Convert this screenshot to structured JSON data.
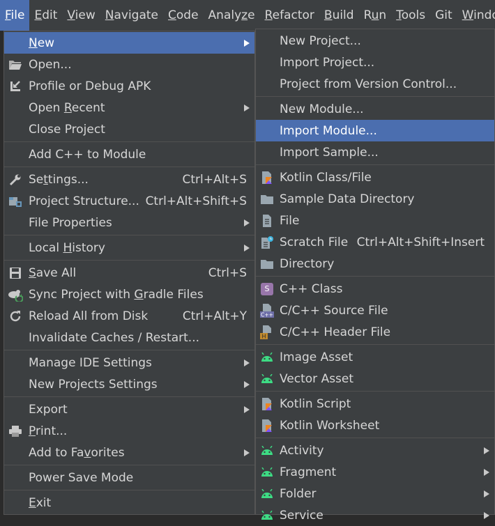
{
  "menubar": [
    {
      "pre": "",
      "u": "F",
      "post": "ile",
      "active": true
    },
    {
      "pre": "",
      "u": "E",
      "post": "dit"
    },
    {
      "pre": "",
      "u": "V",
      "post": "iew"
    },
    {
      "pre": "",
      "u": "N",
      "post": "avigate"
    },
    {
      "pre": "",
      "u": "C",
      "post": "ode"
    },
    {
      "pre": "Analy",
      "u": "z",
      "post": "e"
    },
    {
      "pre": "",
      "u": "R",
      "post": "efactor"
    },
    {
      "pre": "",
      "u": "B",
      "post": "uild"
    },
    {
      "pre": "R",
      "u": "u",
      "post": "n"
    },
    {
      "pre": "",
      "u": "T",
      "post": "ools"
    },
    {
      "pre": "Git",
      "u": "",
      "post": ""
    },
    {
      "pre": "",
      "u": "W",
      "post": "indow"
    }
  ],
  "file_menu": {
    "new": {
      "pre": "",
      "u": "N",
      "post": "ew"
    },
    "open": "Open...",
    "profile": "Profile or Debug APK",
    "open_recent": {
      "pre": "Open ",
      "u": "R",
      "post": "ecent"
    },
    "close_project": "Close Project",
    "add_cpp": "Add C++ to Module",
    "settings": {
      "pre": "Se",
      "u": "t",
      "post": "tings...",
      "shortcut": "Ctrl+Alt+S"
    },
    "project_structure": {
      "label": "Project Structure...",
      "shortcut": "Ctrl+Alt+Shift+S"
    },
    "file_properties": "File Properties",
    "local_history": {
      "pre": "Local ",
      "u": "H",
      "post": "istory"
    },
    "save_all": {
      "pre": "",
      "u": "S",
      "post": "ave All",
      "shortcut": "Ctrl+S"
    },
    "sync": {
      "pre": "Sync Project with ",
      "u": "G",
      "post": "radle Files"
    },
    "reload": {
      "label": "Reload All from Disk",
      "shortcut": "Ctrl+Alt+Y"
    },
    "invalidate": "Invalidate Caches / Restart...",
    "manage_ide": "Manage IDE Settings",
    "new_projects_settings": "New Projects Settings",
    "export": "Export",
    "print": {
      "pre": "",
      "u": "P",
      "post": "rint..."
    },
    "add_favorites": {
      "pre": "Add to Fa",
      "u": "v",
      "post": "orites"
    },
    "power_save": "Power Save Mode",
    "exit": {
      "pre": "",
      "u": "E",
      "post": "xit"
    }
  },
  "new_submenu": {
    "new_project": "New Project...",
    "import_project": "Import Project...",
    "project_from_vcs": "Project from Version Control...",
    "new_module": "New Module...",
    "import_module": "Import Module...",
    "import_sample": "Import Sample...",
    "kotlin_class": "Kotlin Class/File",
    "sample_data_dir": "Sample Data Directory",
    "file": "File",
    "scratch_file": {
      "label": "Scratch File",
      "shortcut": "Ctrl+Alt+Shift+Insert"
    },
    "directory": "Directory",
    "cpp_class": "C++ Class",
    "cpp_source": "C/C++ Source File",
    "cpp_header": "C/C++ Header File",
    "image_asset": "Image Asset",
    "vector_asset": "Vector Asset",
    "kotlin_script": "Kotlin Script",
    "kotlin_worksheet": "Kotlin Worksheet",
    "activity": "Activity",
    "fragment": "Fragment",
    "folder": "Folder",
    "service": "Service"
  },
  "icons": {
    "android_color": "#3ddc84",
    "kotlin_colors": [
      "#7f52ff",
      "#f88909",
      "#e44857"
    ],
    "cpp_class_badge_color": "#9876aa",
    "cpp_class_badge_text": "S",
    "cpp_source_badge_text": "C++",
    "cpp_header_badge_text": "H"
  },
  "colors": {
    "menu_bg": "#3c3f41",
    "selection": "#4b6eaf",
    "separator": "#515151",
    "text": "#d6d6d6"
  }
}
